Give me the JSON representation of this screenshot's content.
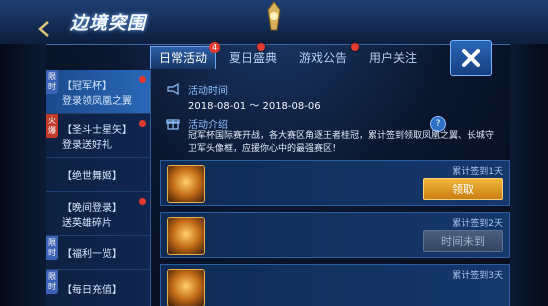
{
  "header": {
    "logo_text": "边境突围"
  },
  "tabs": [
    {
      "label": "日常活动",
      "badge": "4"
    },
    {
      "label": "夏日盛典",
      "badge": ""
    },
    {
      "label": "游戏公告",
      "badge": ""
    },
    {
      "label": "用户关注",
      "badge": ""
    }
  ],
  "sidebar": {
    "items": [
      {
        "tag": "限时",
        "line1": "【冠军杯】",
        "line2": "登录领凤凰之翼"
      },
      {
        "tag": "火爆",
        "line1": "【圣斗士星矢】",
        "line2": "登录送好礼"
      },
      {
        "tag": "",
        "line1": "【绝世舞姬】",
        "line2": ""
      },
      {
        "tag": "",
        "line1": "【晚间登录】",
        "line2": "送英雄碎片"
      },
      {
        "tag": "限时",
        "line1": "【福利一览】",
        "line2": ""
      },
      {
        "tag": "限时",
        "line1": "【每日充值】",
        "line2": ""
      }
    ]
  },
  "event": {
    "time_title": "活动时间",
    "time_range": "2018-08-01 ～ 2018-08-06",
    "intro_title": "活动介绍",
    "intro_text": "冠军杯国际赛开战，各大赛区角逐王者桂冠，累计签到领取凤凰之翼、长城守卫军头像框，应援你心中的最强赛区！",
    "help_label": "?"
  },
  "rewards": [
    {
      "label": "累计签到1天",
      "button": "领取",
      "state": "ready"
    },
    {
      "label": "累计签到2天",
      "button": "时间未到",
      "state": "wait"
    },
    {
      "label": "累计签到3天",
      "button": "",
      "state": "wait"
    }
  ],
  "colors": {
    "accent": "#2e5fa6",
    "badge_red": "#e23b2e",
    "claim_gold": "#f0b73a"
  }
}
